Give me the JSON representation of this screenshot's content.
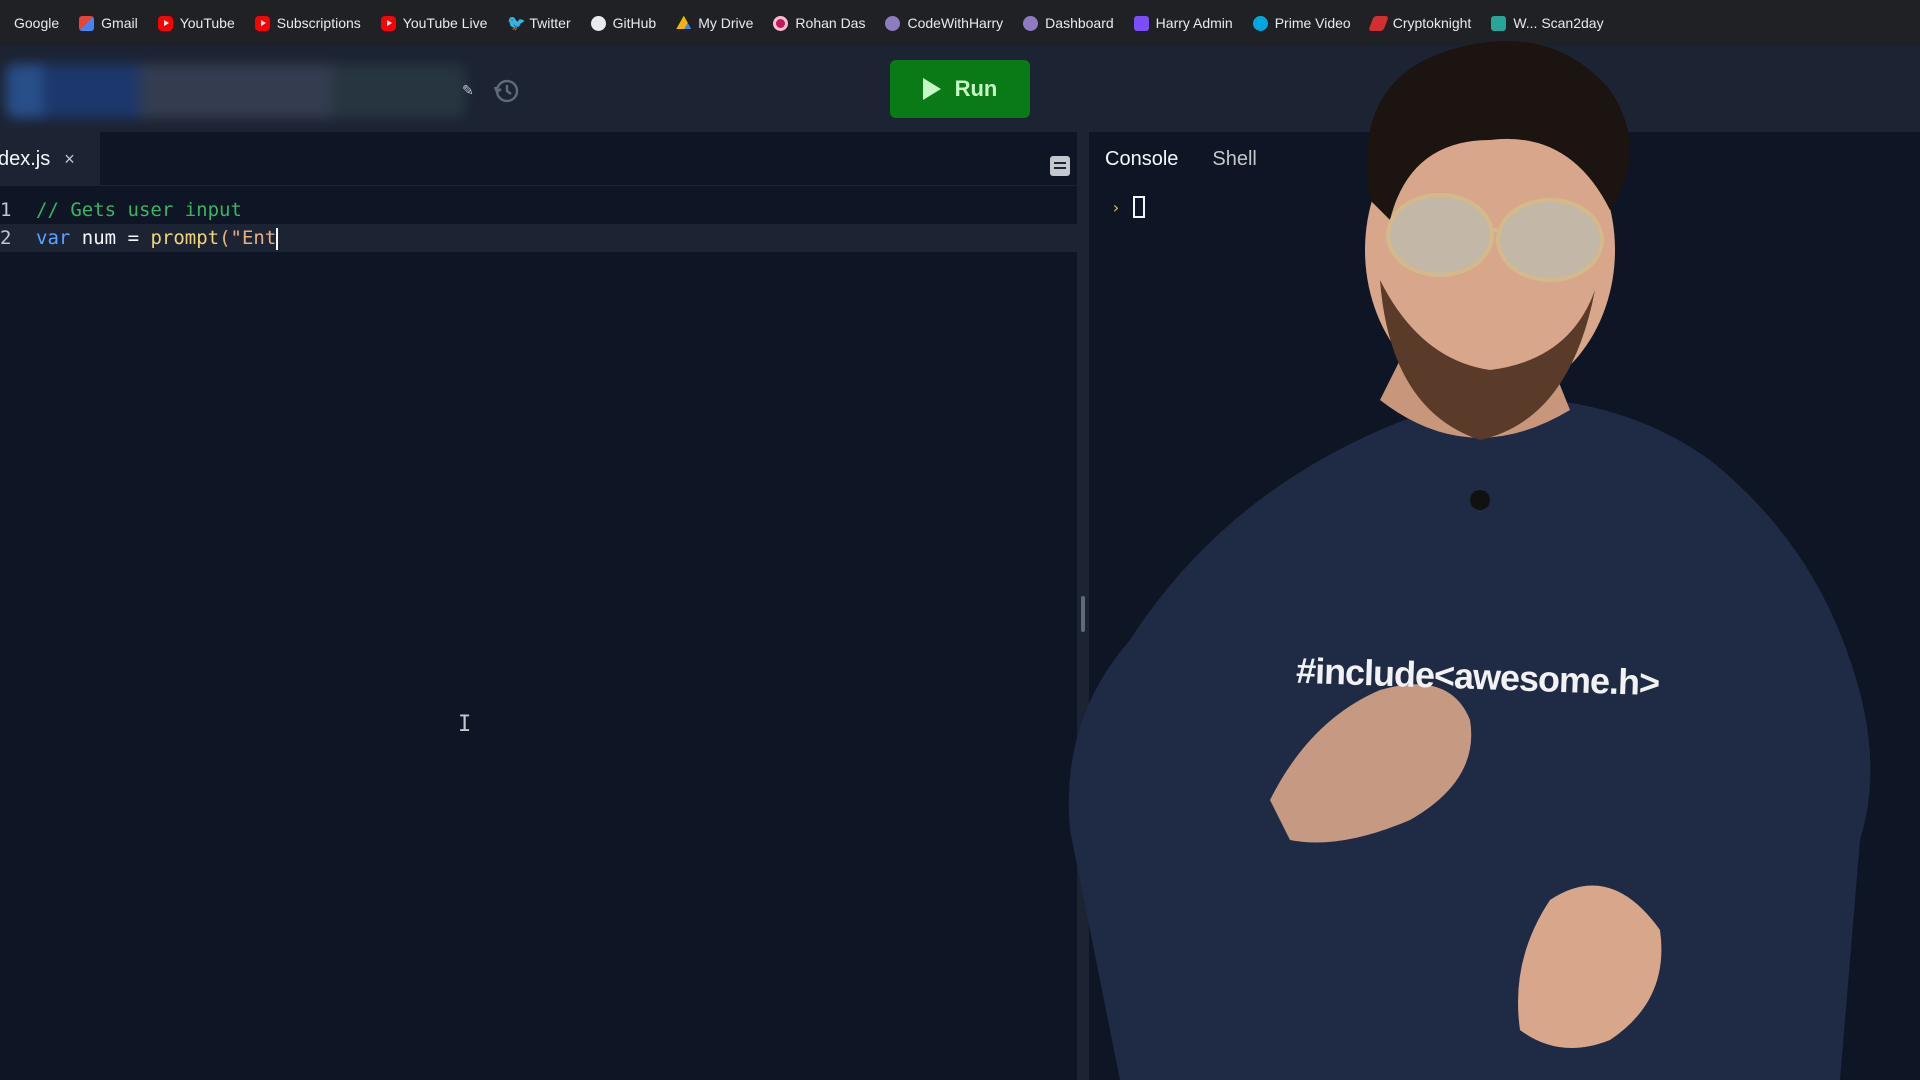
{
  "bookmarks": [
    {
      "label": "Google",
      "icon": "google-icon"
    },
    {
      "label": "Gmail",
      "icon": "gmail-icon"
    },
    {
      "label": "YouTube",
      "icon": "youtube-icon"
    },
    {
      "label": "Subscriptions",
      "icon": "youtube-icon"
    },
    {
      "label": "YouTube Live",
      "icon": "youtube-icon"
    },
    {
      "label": "Twitter",
      "icon": "twitter-icon"
    },
    {
      "label": "GitHub",
      "icon": "github-icon"
    },
    {
      "label": "My Drive",
      "icon": "drive-icon"
    },
    {
      "label": "Rohan Das",
      "icon": "bookmark-icon"
    },
    {
      "label": "CodeWithHarry",
      "icon": "bookmark-icon"
    },
    {
      "label": "Dashboard",
      "icon": "bookmark-icon"
    },
    {
      "label": "Harry Admin",
      "icon": "bookmark-icon"
    },
    {
      "label": "Prime Video",
      "icon": "prime-video-icon"
    },
    {
      "label": "Cryptoknight",
      "icon": "bookmark-icon"
    },
    {
      "label": "W... Scan2day",
      "icon": "bookmark-icon"
    }
  ],
  "toolbar": {
    "run_label": "Run",
    "run_color": "#0a7a16"
  },
  "editor": {
    "tab_name": "dex.js",
    "close_glyph": "×",
    "lines": [
      {
        "number": "1",
        "comment": "// Gets user input"
      },
      {
        "number": "2",
        "keyword": "var",
        "ident": "num",
        "op": "=",
        "fn": "prompt",
        "rest": "(\"Ent"
      }
    ]
  },
  "console": {
    "tabs": [
      "Console",
      "Shell"
    ],
    "active_tab": "Console",
    "prompt_symbol": "›"
  },
  "presenter": {
    "shirt_text": "#include<awesome.h>"
  }
}
